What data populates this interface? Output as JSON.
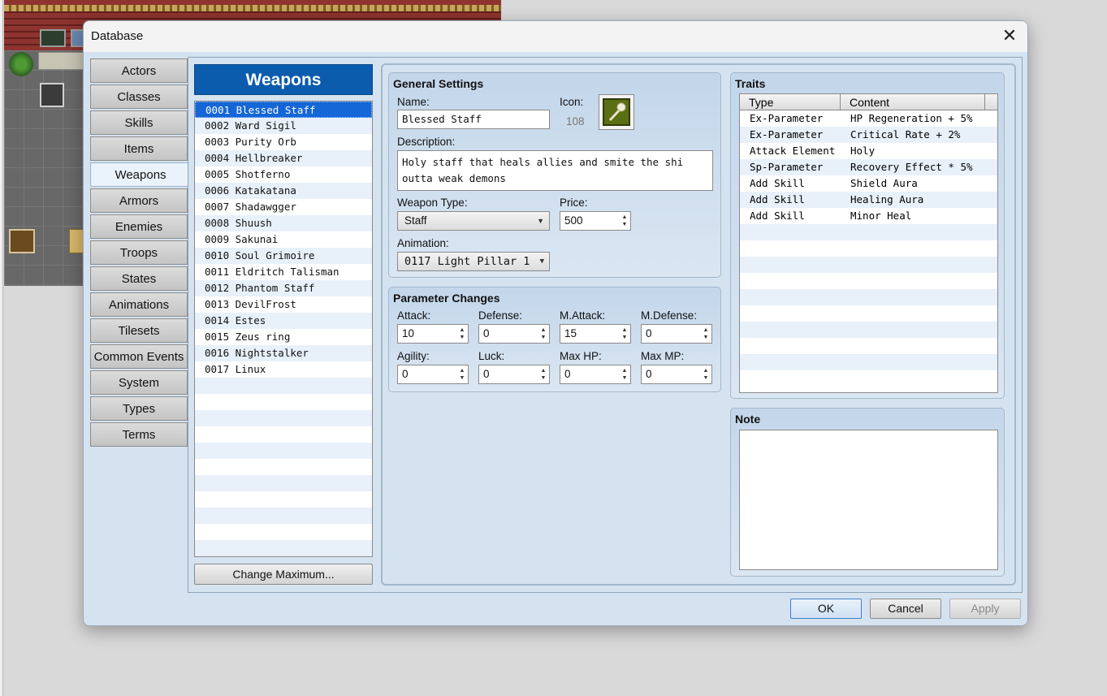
{
  "window": {
    "title": "Database",
    "close_glyph": "✕"
  },
  "tabs": [
    "Actors",
    "Classes",
    "Skills",
    "Items",
    "Weapons",
    "Armors",
    "Enemies",
    "Troops",
    "States",
    "Animations",
    "Tilesets",
    "Common Events",
    "System",
    "Types",
    "Terms"
  ],
  "active_tab": "Weapons",
  "list": {
    "header": "Weapons",
    "items": [
      "0001 Blessed Staff",
      "0002 Ward Sigil",
      "0003 Purity Orb",
      "0004 Hellbreaker",
      "0005 Shotferno",
      "0006 Katakatana",
      "0007 Shadawgger",
      "0008 Shuush",
      "0009 Sakunai",
      "0010 Soul Grimoire",
      "0011 Eldritch Talisman",
      "0012 Phantom Staff",
      "0013 DevilFrost",
      "0014 Estes",
      "0015 Zeus ring",
      "0016 Nightstalker",
      "0017 Linux"
    ],
    "selected": "0001 Blessed Staff",
    "change_max_label": "Change Maximum..."
  },
  "general": {
    "title": "General Settings",
    "name_label": "Name:",
    "name_value": "Blessed Staff",
    "icon_label": "Icon:",
    "icon_index": "108",
    "icon_name": "staff-icon",
    "description_label": "Description:",
    "description_value": "Holy staff that heals allies and smite the shi\noutta weak demons",
    "weapon_type_label": "Weapon Type:",
    "weapon_type_value": "Staff",
    "price_label": "Price:",
    "price_value": "500",
    "animation_label": "Animation:",
    "animation_value": "0117 Light Pillar 1"
  },
  "params": {
    "title": "Parameter Changes",
    "fields": [
      {
        "label": "Attack:",
        "value": "10"
      },
      {
        "label": "Defense:",
        "value": "0"
      },
      {
        "label": "M.Attack:",
        "value": "15"
      },
      {
        "label": "M.Defense:",
        "value": "0"
      },
      {
        "label": "Agility:",
        "value": "0"
      },
      {
        "label": "Luck:",
        "value": "0"
      },
      {
        "label": "Max HP:",
        "value": "0"
      },
      {
        "label": "Max MP:",
        "value": "0"
      }
    ]
  },
  "traits": {
    "title": "Traits",
    "col_type": "Type",
    "col_content": "Content",
    "rows": [
      {
        "type": "Ex-Parameter",
        "content": "HP Regeneration + 5%"
      },
      {
        "type": "Ex-Parameter",
        "content": "Critical Rate + 2%"
      },
      {
        "type": "Attack Element",
        "content": "Holy"
      },
      {
        "type": "Sp-Parameter",
        "content": "Recovery Effect * 5%"
      },
      {
        "type": "Add Skill",
        "content": "Shield Aura"
      },
      {
        "type": "Add Skill",
        "content": "Healing Aura"
      },
      {
        "type": "Add Skill",
        "content": "Minor Heal"
      }
    ]
  },
  "note": {
    "title": "Note",
    "value": ""
  },
  "buttons": {
    "ok": "OK",
    "cancel": "Cancel",
    "apply": "Apply"
  },
  "colors": {
    "list_header": "#0b5cad",
    "selection": "#1566d6",
    "panel": "#d5e3f0"
  }
}
